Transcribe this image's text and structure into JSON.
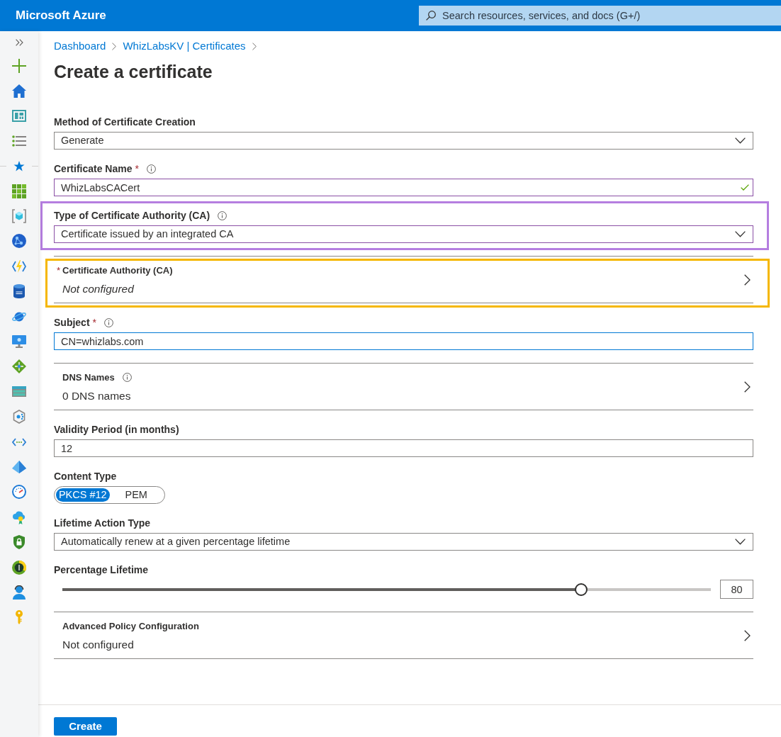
{
  "header": {
    "brand": "Microsoft Azure",
    "search": {
      "placeholder": "Search resources, services, and docs (G+/)"
    }
  },
  "breadcrumb": [
    {
      "label": "Dashboard"
    },
    {
      "label": "WhizLabsKV | Certificates"
    }
  ],
  "title": "Create a certificate",
  "fields": [
    {
      "kind": "select",
      "label": "Method of Certificate Creation",
      "info": false,
      "edited": false,
      "focused": false,
      "highlighted": false,
      "value": "Generate"
    },
    {
      "kind": "text",
      "label": "Certificate Name",
      "required_mark": "*",
      "info": true,
      "edited": true,
      "focused": false,
      "highlighted": false,
      "value": "WhizLabsCACert",
      "valid": true
    },
    {
      "kind": "select",
      "label": "Type of Certificate Authority (CA)",
      "info": true,
      "edited": true,
      "focused": false,
      "highlighted": true,
      "color": "#b57ee0",
      "value": "Certificate issued by an integrated CA"
    },
    {
      "kind": "link",
      "label": "Certificate Authority (CA)",
      "required_mark": "*",
      "info": false,
      "highlighted": true,
      "color": "#f5b700",
      "value": "Not configured",
      "italic": true
    },
    {
      "kind": "text",
      "label": "Subject",
      "required_mark": "*",
      "info": true,
      "edited": false,
      "focused": true,
      "highlighted": false,
      "value": "CN=whizlabs.com",
      "valid": false
    },
    {
      "kind": "link",
      "label": "DNS Names",
      "info": true,
      "highlighted": false,
      "value": "0 DNS names",
      "italic": false
    },
    {
      "kind": "text",
      "label": "Validity Period (in months)",
      "info": false,
      "edited": false,
      "focused": false,
      "highlighted": false,
      "value": "12",
      "valid": false
    },
    {
      "kind": "toggle",
      "label": "Content Type",
      "info": false,
      "highlighted": false,
      "options": [
        {
          "label": "PKCS #12",
          "selected": true
        },
        {
          "label": "PEM",
          "selected": false
        }
      ]
    },
    {
      "kind": "select",
      "label": "Lifetime Action Type",
      "info": false,
      "edited": false,
      "focused": false,
      "highlighted": false,
      "value": "Automatically renew at a given percentage lifetime"
    },
    {
      "kind": "slider",
      "label": "Percentage Lifetime",
      "info": false,
      "highlighted": false,
      "level": 0.8,
      "reading": "80"
    },
    {
      "kind": "link",
      "label": "Advanced Policy Configuration",
      "info": false,
      "highlighted": false,
      "value": "Not configured",
      "italic": false
    }
  ],
  "create_button": "Create"
}
